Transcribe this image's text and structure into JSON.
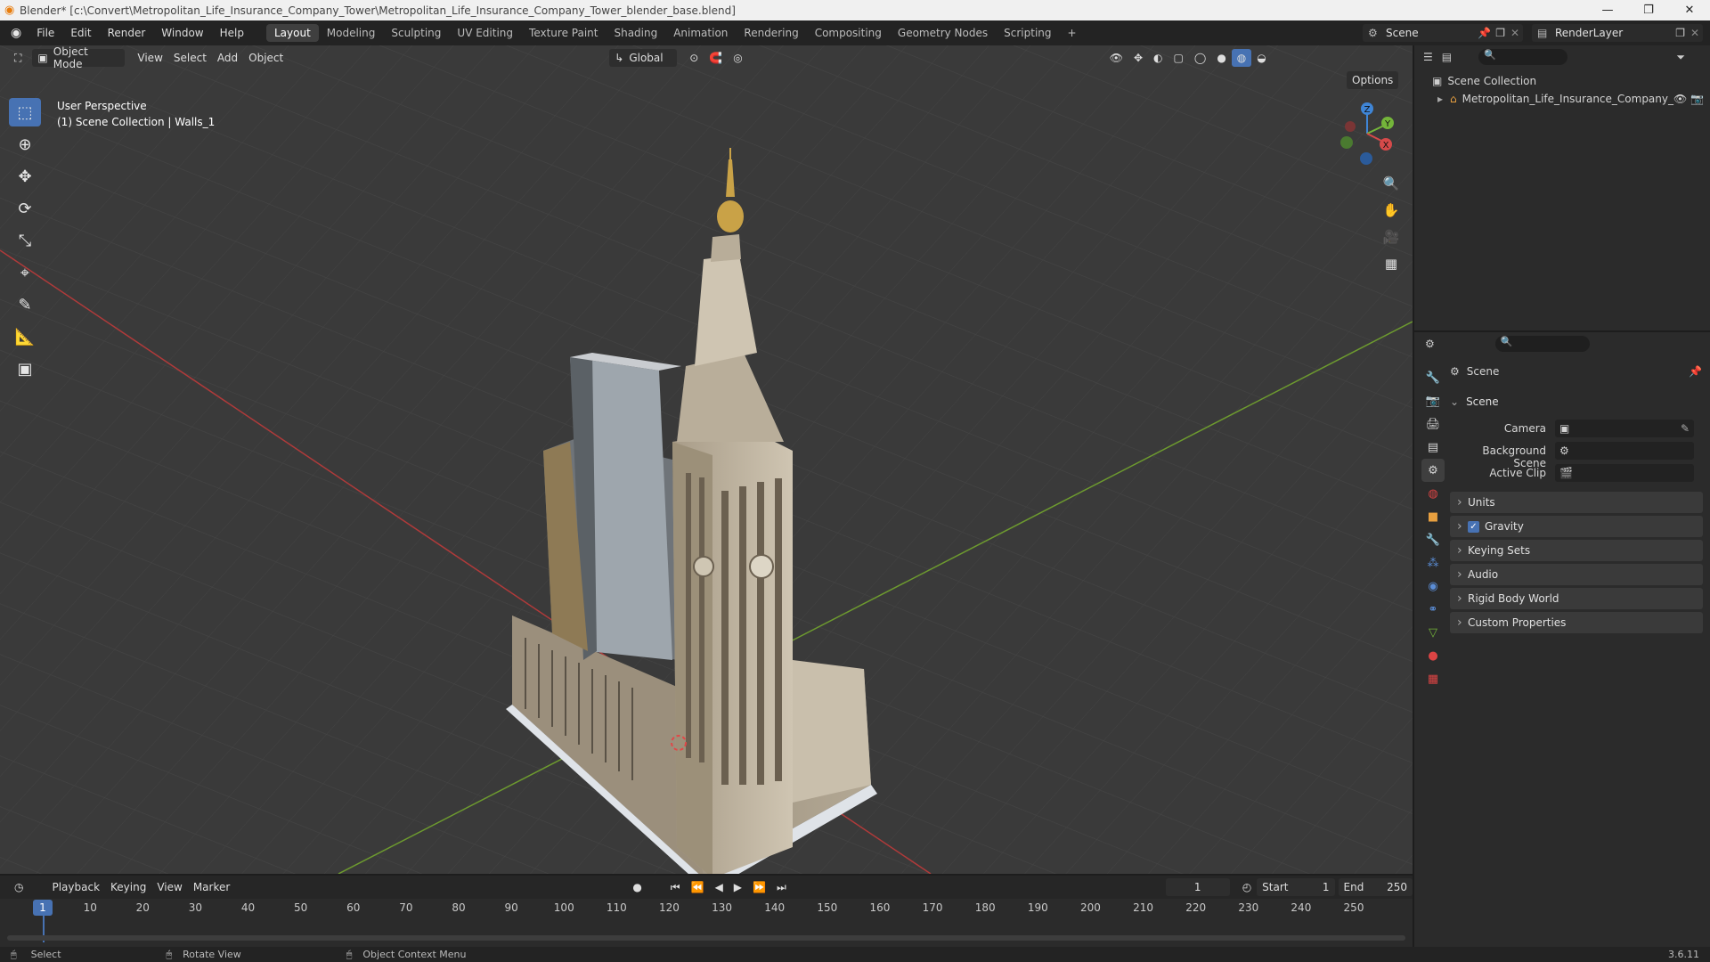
{
  "window": {
    "title": "Blender* [c:\\Convert\\Metropolitan_Life_Insurance_Company_Tower\\Metropolitan_Life_Insurance_Company_Tower_blender_base.blend]",
    "min": "—",
    "max": "❐",
    "close": "✕"
  },
  "menu": [
    "File",
    "Edit",
    "Render",
    "Window",
    "Help"
  ],
  "workspaces": [
    "Layout",
    "Modeling",
    "Sculpting",
    "UV Editing",
    "Texture Paint",
    "Shading",
    "Animation",
    "Rendering",
    "Compositing",
    "Geometry Nodes",
    "Scripting"
  ],
  "add_workspace": "+",
  "scene_name": "Scene",
  "view_layer": "RenderLayer",
  "viewport": {
    "mode": "Object Mode",
    "menus": [
      "View",
      "Select",
      "Add",
      "Object"
    ],
    "orientation": "Global",
    "options": "Options",
    "info_line1": "User Perspective",
    "info_line2": "(1) Scene Collection | Walls_1",
    "gizmo": {
      "x": "X",
      "y": "Y",
      "z": "Z"
    }
  },
  "outliner": {
    "root": "Scene Collection",
    "items": [
      {
        "label": "Metropolitan_Life_Insurance_Company_"
      }
    ]
  },
  "properties": {
    "header": "Scene",
    "section": "Scene",
    "fields": {
      "camera": "Camera",
      "background_scene": "Background Scene",
      "active_clip": "Active Clip"
    },
    "panels": [
      "Units",
      "Gravity",
      "Keying Sets",
      "Audio",
      "Rigid Body World",
      "Custom Properties"
    ],
    "gravity_checked": true
  },
  "timeline": {
    "menus": [
      "Playback",
      "Keying",
      "View",
      "Marker"
    ],
    "current_frame": "1",
    "start_label": "Start",
    "start": "1",
    "end_label": "End",
    "end": "250",
    "ticks": [
      "1",
      "10",
      "20",
      "30",
      "40",
      "50",
      "60",
      "70",
      "80",
      "90",
      "100",
      "110",
      "120",
      "130",
      "140",
      "150",
      "160",
      "170",
      "180",
      "190",
      "200",
      "210",
      "220",
      "230",
      "240",
      "250"
    ]
  },
  "status": {
    "select": "Select",
    "rotate": "Rotate View",
    "context": "Object Context Menu",
    "version": "3.6.11"
  },
  "colors": {
    "accent": "#4772b3",
    "x_axis": "#d64a4a",
    "y_axis": "#74b53a",
    "z_axis": "#3f85d6"
  }
}
